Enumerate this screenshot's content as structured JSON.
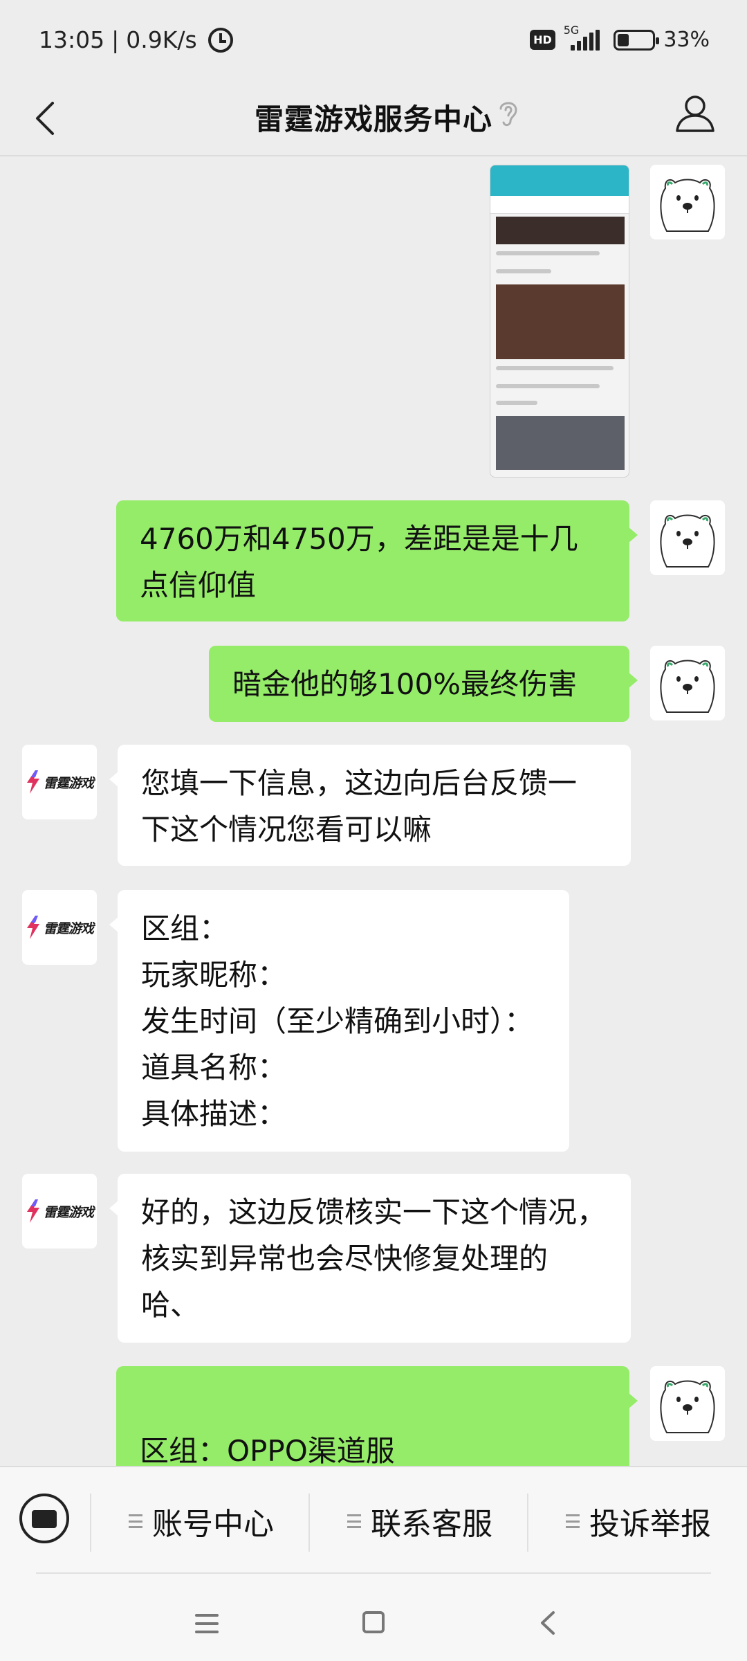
{
  "status_bar": {
    "time": "13:05",
    "separator": "|",
    "speed": "0.9K/s",
    "hd": "HD",
    "network": "5G",
    "battery": "33%",
    "battery_level": 0.33
  },
  "header": {
    "title": "雷霆游戏服务中心"
  },
  "avatars": {
    "service_logo_text": "雷霆游戏"
  },
  "messages": [
    {
      "side": "out",
      "type": "image"
    },
    {
      "side": "out",
      "type": "text",
      "text": "4760万和4750万，差距是是十几\n点信仰值"
    },
    {
      "side": "out",
      "type": "text",
      "text": "暗金他的够100%最终伤害"
    },
    {
      "side": "in",
      "type": "text",
      "text": "您填一下信息，这边向后台反馈一\n下这个情况您看可以嘛"
    },
    {
      "side": "in",
      "type": "text",
      "text": "区组：\n玩家昵称：\n发生时间（至少精确到小时）：\n道具名称：\n具体描述："
    },
    {
      "side": "in",
      "type": "text",
      "text": "好的，这边反馈核实一下这个情况，\n核实到异常也会尽快修复处理的\n哈、"
    },
    {
      "side": "out",
      "type": "text",
      "text": "\n区组：OPPO渠道服"
    }
  ],
  "bottom_menu": {
    "items": [
      "账号中心",
      "联系客服",
      "投诉举报"
    ]
  }
}
